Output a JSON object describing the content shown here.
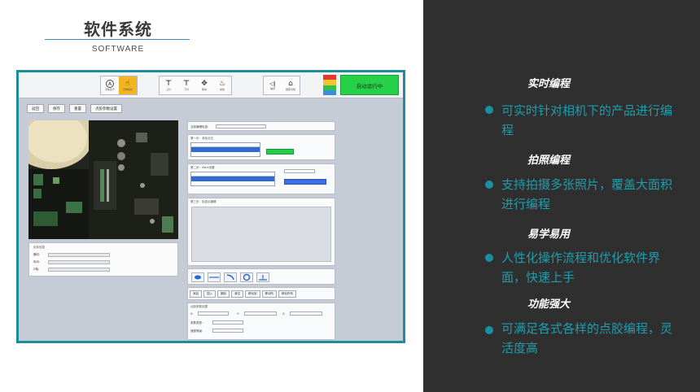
{
  "slide": {
    "title": "软件系统",
    "subtitle": "SOFTWARE"
  },
  "software": {
    "toolbar": [
      {
        "group": 1,
        "buttons": [
          {
            "icon": "A",
            "label": "清除生产"
          },
          {
            "icon": "☝",
            "label": "示教模式",
            "active": true
          }
        ]
      },
      {
        "group": 2,
        "buttons": [
          {
            "icon": "⊤",
            "label": "上针"
          },
          {
            "icon": "⊥",
            "label": "下针"
          },
          {
            "icon": "✥",
            "label": "移动"
          },
          {
            "icon": "♨",
            "label": "加热"
          }
        ]
      },
      {
        "group": 3,
        "buttons": [
          {
            "icon": "🔈",
            "label": "静音"
          },
          {
            "icon": "⌂",
            "label": "报警清除"
          }
        ]
      }
    ],
    "status_colors": [
      "#e23a2e",
      "#f2c52c",
      "#2cc34a",
      "#3b8fe0"
    ],
    "auto_run_label": "自动运行中",
    "action_buttons": [
      "返回",
      "保存",
      "重置",
      "点胶参数设置"
    ],
    "info_panel": {
      "title": "坐标信息",
      "rows": [
        "横向:",
        "纵向:",
        "Z轴:"
      ]
    },
    "step_panels": {
      "select_label": "当前编辑轨迹:",
      "step1_title": "第一步：添加点位",
      "step2_title": "第二步：Mark设置",
      "step2_button": "获取Mark位置信息",
      "step3_title": "第三步：轨迹点编辑",
      "green_button": "确定",
      "ops": [
        "添加",
        "插入",
        "删除",
        "清空",
        "移动到",
        "移动所",
        "移动所有"
      ],
      "param_title": "点胶参数设置",
      "param_fields": [
        "X:",
        "Y:",
        "Z:"
      ],
      "param_selects": [
        "参数类型:",
        "速度等级:"
      ]
    }
  },
  "features": [
    {
      "heading": "实时编程",
      "text": "可实时针对相机下的产品进行编程"
    },
    {
      "heading": "拍照编程",
      "text": "支持拍摄多张照片，覆盖大面积进行编程"
    },
    {
      "heading": "易学易用",
      "text": "人性化操作流程和优化软件界面，快速上手"
    },
    {
      "heading": "功能强大",
      "text": "可满足各式各样的点胶编程，灵活度高"
    }
  ]
}
